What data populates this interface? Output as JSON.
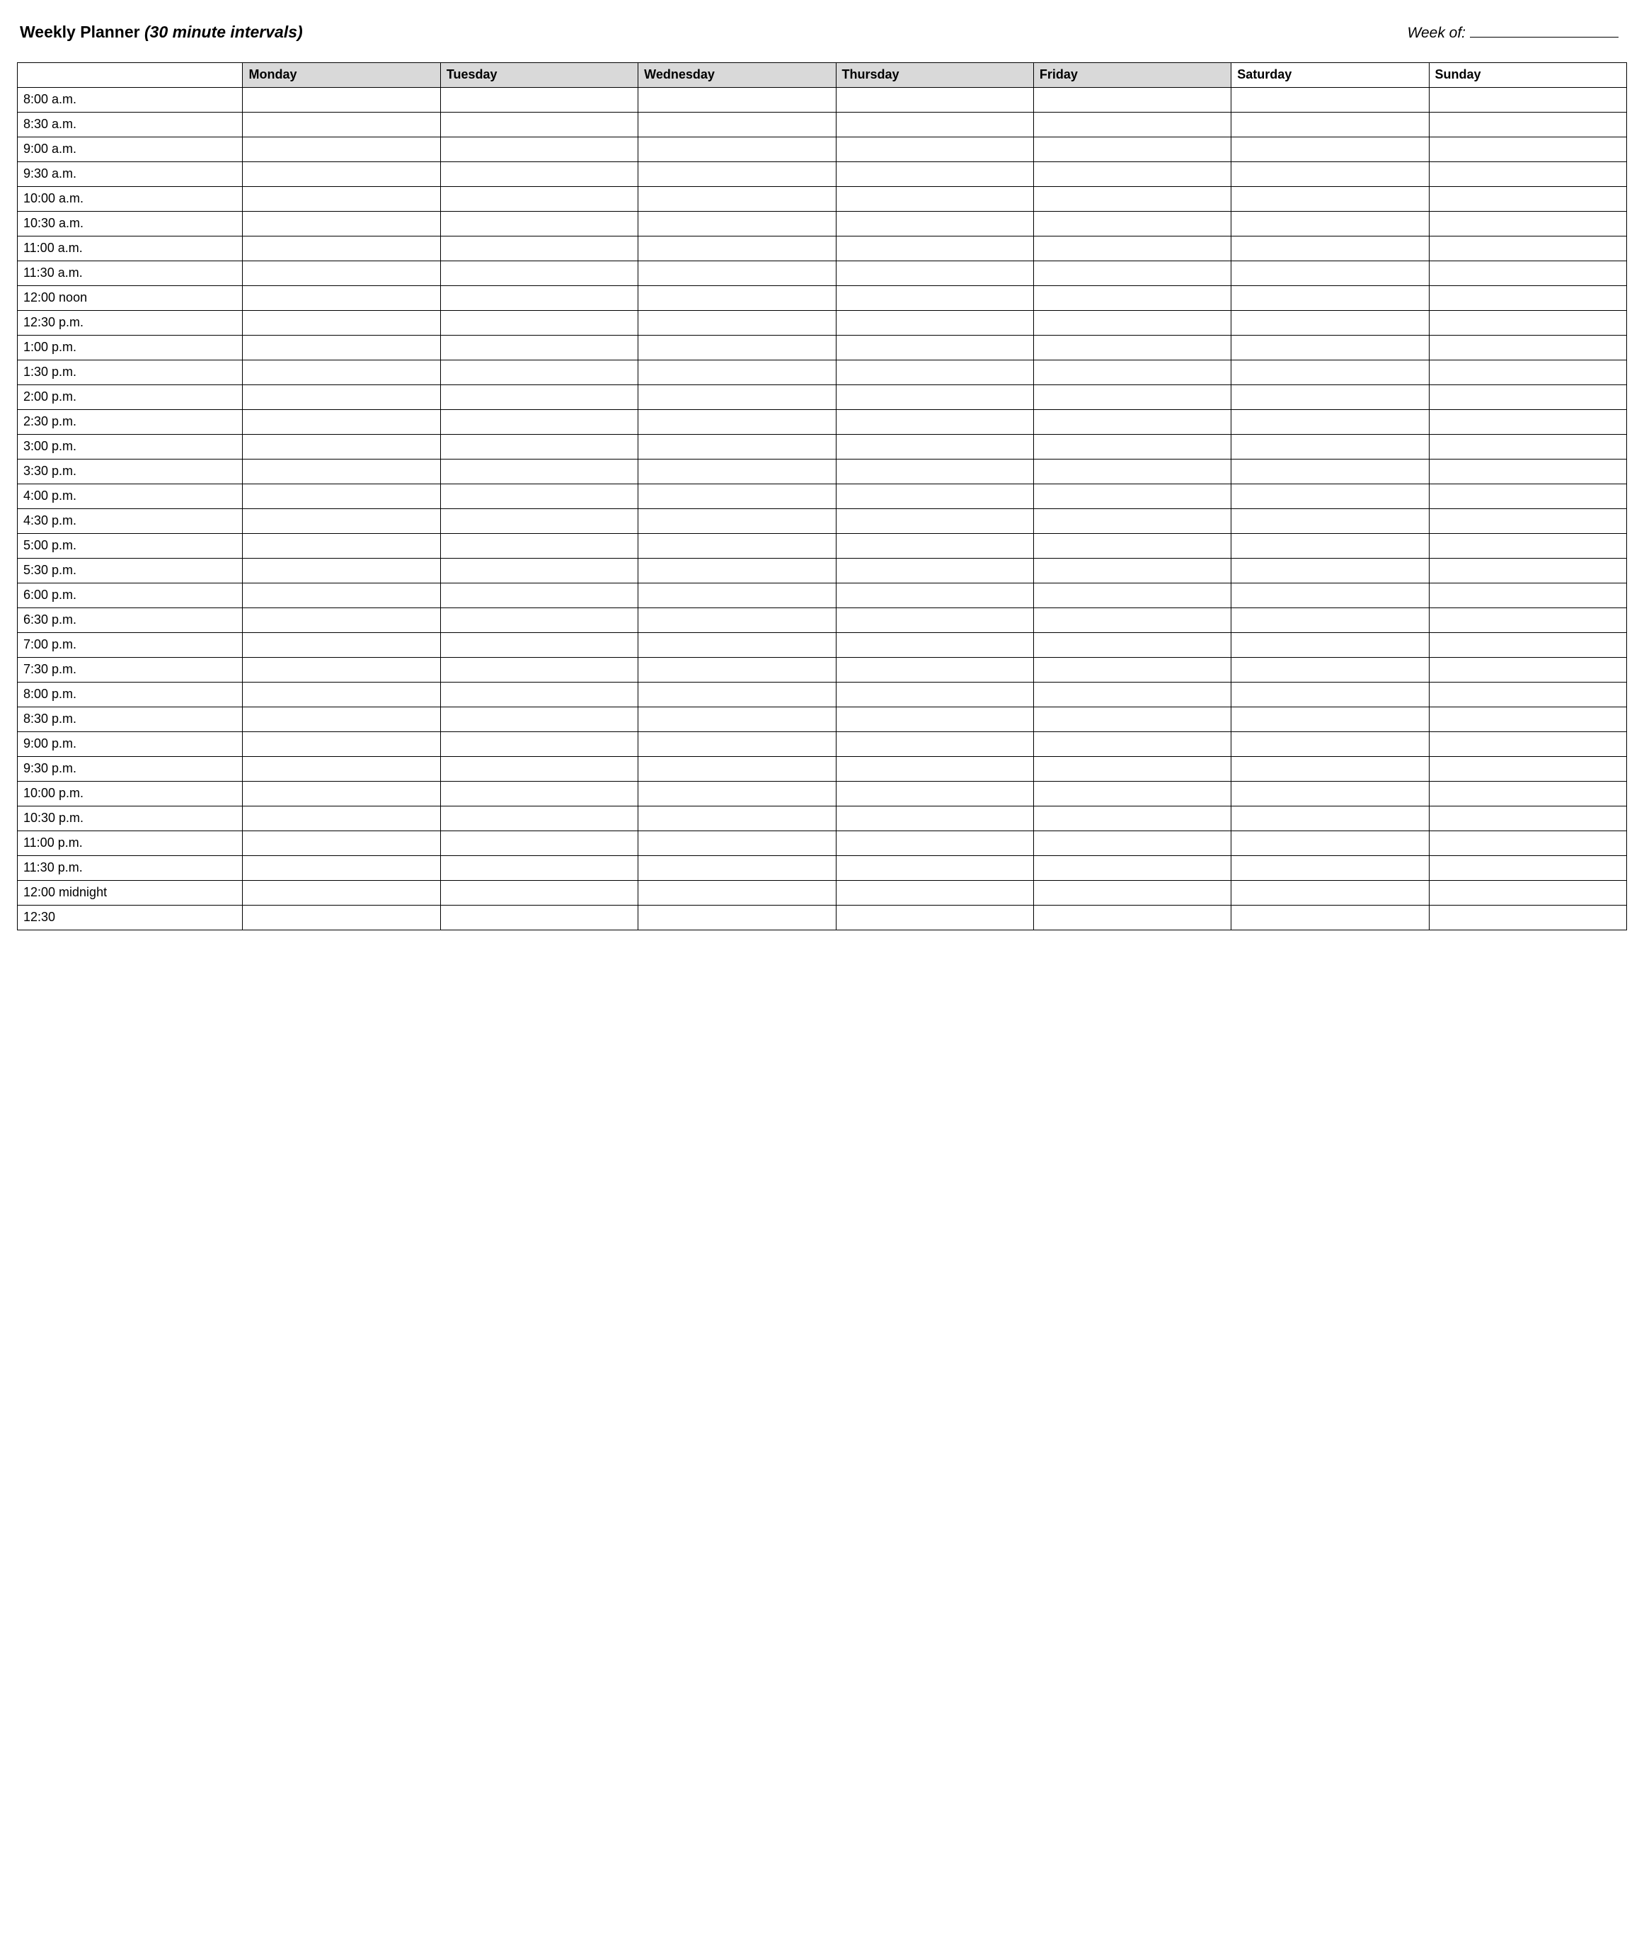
{
  "header": {
    "title_main": "Weekly Planner",
    "title_sub": "(30 minute intervals)",
    "week_of_label": "Week of:",
    "week_of_value": ""
  },
  "days": [
    {
      "label": "Monday",
      "shaded": true
    },
    {
      "label": "Tuesday",
      "shaded": true
    },
    {
      "label": "Wednesday",
      "shaded": true
    },
    {
      "label": "Thursday",
      "shaded": true
    },
    {
      "label": "Friday",
      "shaded": true
    },
    {
      "label": "Saturday",
      "shaded": false
    },
    {
      "label": "Sunday",
      "shaded": false
    }
  ],
  "time_slots": [
    "8:00 a.m.",
    "8:30 a.m.",
    "9:00 a.m.",
    "9:30 a.m.",
    "10:00 a.m.",
    "10:30 a.m.",
    "11:00 a.m.",
    "11:30 a.m.",
    "12:00 noon",
    "12:30 p.m.",
    "1:00 p.m.",
    "1:30 p.m.",
    "2:00 p.m.",
    "2:30 p.m.",
    "3:00 p.m.",
    "3:30 p.m.",
    "4:00 p.m.",
    "4:30 p.m.",
    "5:00 p.m.",
    "5:30 p.m.",
    "6:00 p.m.",
    "6:30 p.m.",
    "7:00 p.m.",
    "7:30 p.m.",
    "8:00 p.m.",
    "8:30 p.m.",
    "9:00 p.m.",
    "9:30 p.m.",
    "10:00 p.m.",
    "10:30 p.m.",
    "11:00 p.m.",
    "11:30 p.m.",
    "12:00 midnight",
    "12:30"
  ]
}
